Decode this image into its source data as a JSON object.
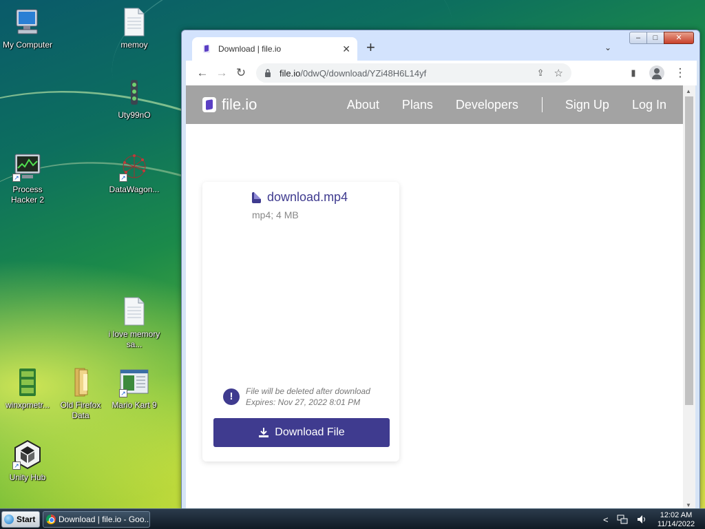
{
  "desktop": {
    "icons": [
      {
        "label": "My Computer",
        "icon": "computer-icon"
      },
      {
        "label": "memoy",
        "icon": "text-file-icon"
      },
      {
        "label": "Uty99nO",
        "icon": "traffic-light-icon"
      },
      {
        "label": "Process Hacker 2",
        "icon": "process-hacker-icon"
      },
      {
        "label": "DataWagon...",
        "icon": "network-graph-icon"
      },
      {
        "label": "i love memory sa...",
        "icon": "text-file-icon"
      },
      {
        "label": "winxpmetr...",
        "icon": "green-app-icon"
      },
      {
        "label": "Old Firefox Data",
        "icon": "folder-icon"
      },
      {
        "label": "Mario Kart 9",
        "icon": "window-app-icon"
      },
      {
        "label": "Unity Hub",
        "icon": "unity-icon"
      }
    ]
  },
  "browser": {
    "tab": {
      "title": "Download | file.io",
      "close": "✕"
    },
    "new_tab": "+",
    "tab_menu": "⌄",
    "window_controls": {
      "minimize": "–",
      "maximize": "□",
      "close": "✕"
    },
    "toolbar": {
      "back": "←",
      "forward": "→",
      "reload": "↻",
      "share": "⇪",
      "bookmark": "☆",
      "sidepanel": "▮",
      "menu": "⋮"
    },
    "address": {
      "host": "file.io",
      "path": "/0dwQ/download/YZi48H6L14yf"
    }
  },
  "site": {
    "logo": "file.io",
    "nav": [
      "About",
      "Plans",
      "Developers",
      "Sign Up",
      "Log In"
    ]
  },
  "file_card": {
    "filename": "download.mp4",
    "meta": "mp4; 4 MB",
    "notice_line1": "File will be deleted after download",
    "notice_line2": "Expires: Nov 27, 2022 8:01 PM",
    "button": "Download File"
  },
  "taskbar": {
    "start": "Start",
    "task": "Download | file.io - Goo...",
    "tray_chevron": "<",
    "time": "12:02 AM",
    "date": "11/14/2022"
  },
  "colors": {
    "brand": "#3f3b8f",
    "nav_bg": "#a3a3a3"
  }
}
